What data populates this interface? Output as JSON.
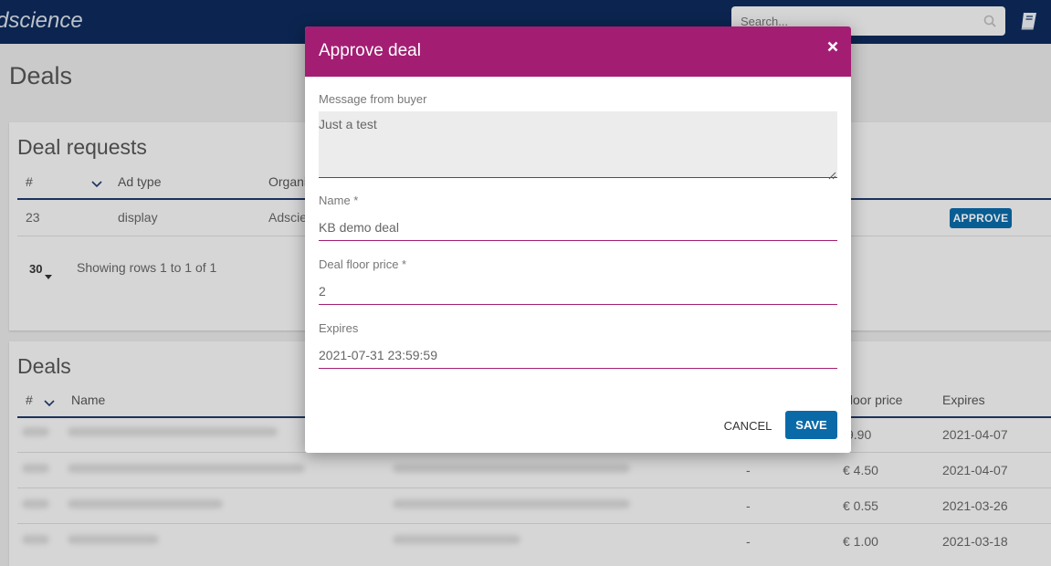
{
  "app": {
    "brand": "dscience"
  },
  "search": {
    "placeholder": "Search..."
  },
  "page": {
    "title": "Deals"
  },
  "deal_requests": {
    "title": "Deal requests",
    "headers": [
      "#",
      "Ad type",
      "Organi"
    ],
    "row": {
      "id": "23",
      "ad_type": "display",
      "organization": "Adscie",
      "action": "APPROVE"
    },
    "page_size": "30",
    "showing": "Showing rows 1 to 1 of 1"
  },
  "deals": {
    "title": "Deals",
    "headers": [
      "#",
      "Name",
      "floor price",
      "Expires"
    ],
    "rows": [
      {
        "col": "",
        "price": "9.90",
        "expires": "2021-04-07"
      },
      {
        "col": "-",
        "price": "€ 4.50",
        "expires": "2021-04-07"
      },
      {
        "col": "-",
        "price": "€ 0.55",
        "expires": "2021-03-26"
      },
      {
        "col": "-",
        "price": "€ 1.00",
        "expires": "2021-03-18"
      }
    ]
  },
  "modal": {
    "title": "Approve deal",
    "message_label": "Message from buyer",
    "message_value": "Just a test",
    "name_label": "Name *",
    "name_value": "KB demo deal",
    "floor_label": "Deal floor price *",
    "floor_value": "2",
    "expires_label": "Expires",
    "expires_value": "2021-07-31 23:59:59",
    "cancel": "CANCEL",
    "save": "SAVE"
  },
  "colors": {
    "header": "#0d2b5c",
    "modal_header": "#a31e73",
    "primary_button": "#0a6aa8"
  }
}
